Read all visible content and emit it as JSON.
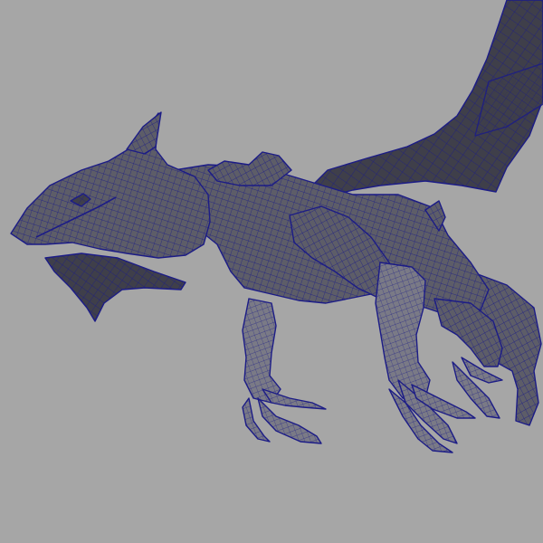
{
  "scene": {
    "subject": "dragon-wireframe-mesh",
    "colors": {
      "background": "#a6a6a6",
      "mesh_fill": "#5d5d68",
      "mesh_fill_dark": "#3f3f4a",
      "mesh_fill_light": "#7a7a86",
      "wire": "#1c1c86",
      "wire_highlight": "#3434b0"
    }
  }
}
